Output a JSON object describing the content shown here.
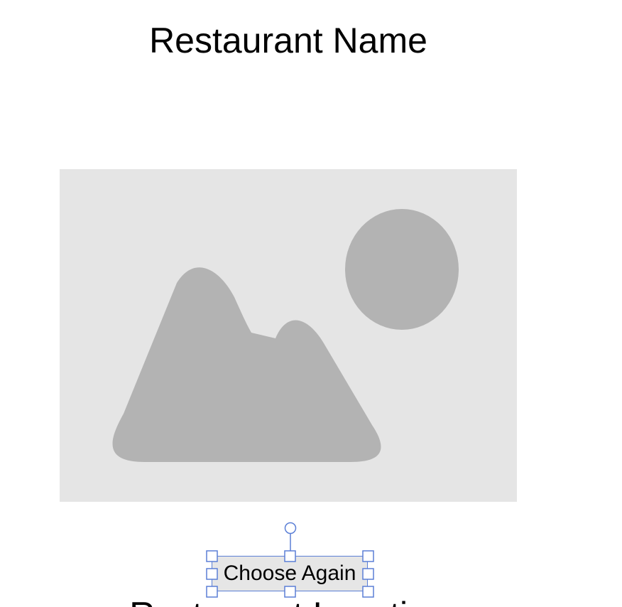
{
  "page": {
    "title": "Restaurant Name",
    "location_label": "Restaurant Location"
  },
  "image": {
    "icon": "image-placeholder-icon",
    "background_color": "#e5e5e5",
    "shape_color": "#b3b3b3"
  },
  "actions": {
    "choose_again_label": "Choose Again"
  },
  "editor": {
    "selection_color": "#5b7fd6",
    "selected_element": "Choose Again"
  }
}
